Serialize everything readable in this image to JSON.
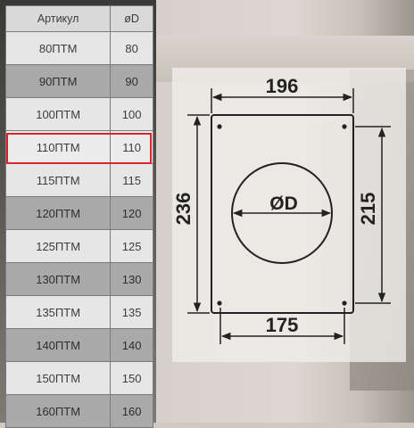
{
  "table": {
    "headers": [
      "Артикул",
      "øD"
    ],
    "rows": [
      {
        "article": "80ПТМ",
        "diameter": "80"
      },
      {
        "article": "90ПТМ",
        "diameter": "90"
      },
      {
        "article": "100ПТМ",
        "diameter": "100"
      },
      {
        "article": "110ПТМ",
        "diameter": "110"
      },
      {
        "article": "115ПТМ",
        "diameter": "115"
      },
      {
        "article": "120ПТМ",
        "diameter": "120"
      },
      {
        "article": "125ПТМ",
        "diameter": "125"
      },
      {
        "article": "130ПТМ",
        "diameter": "130"
      },
      {
        "article": "135ПТМ",
        "diameter": "135"
      },
      {
        "article": "140ПТМ",
        "diameter": "140"
      },
      {
        "article": "150ПТМ",
        "diameter": "150"
      },
      {
        "article": "160ПТМ",
        "diameter": "160"
      }
    ],
    "highlighted_row": 3
  },
  "diagram": {
    "width_top": "196",
    "width_bottom": "175",
    "height_left": "236",
    "height_right": "215",
    "hole_label": "ØD"
  },
  "colors": {
    "highlight": "#e0232a",
    "line": "#222222"
  }
}
